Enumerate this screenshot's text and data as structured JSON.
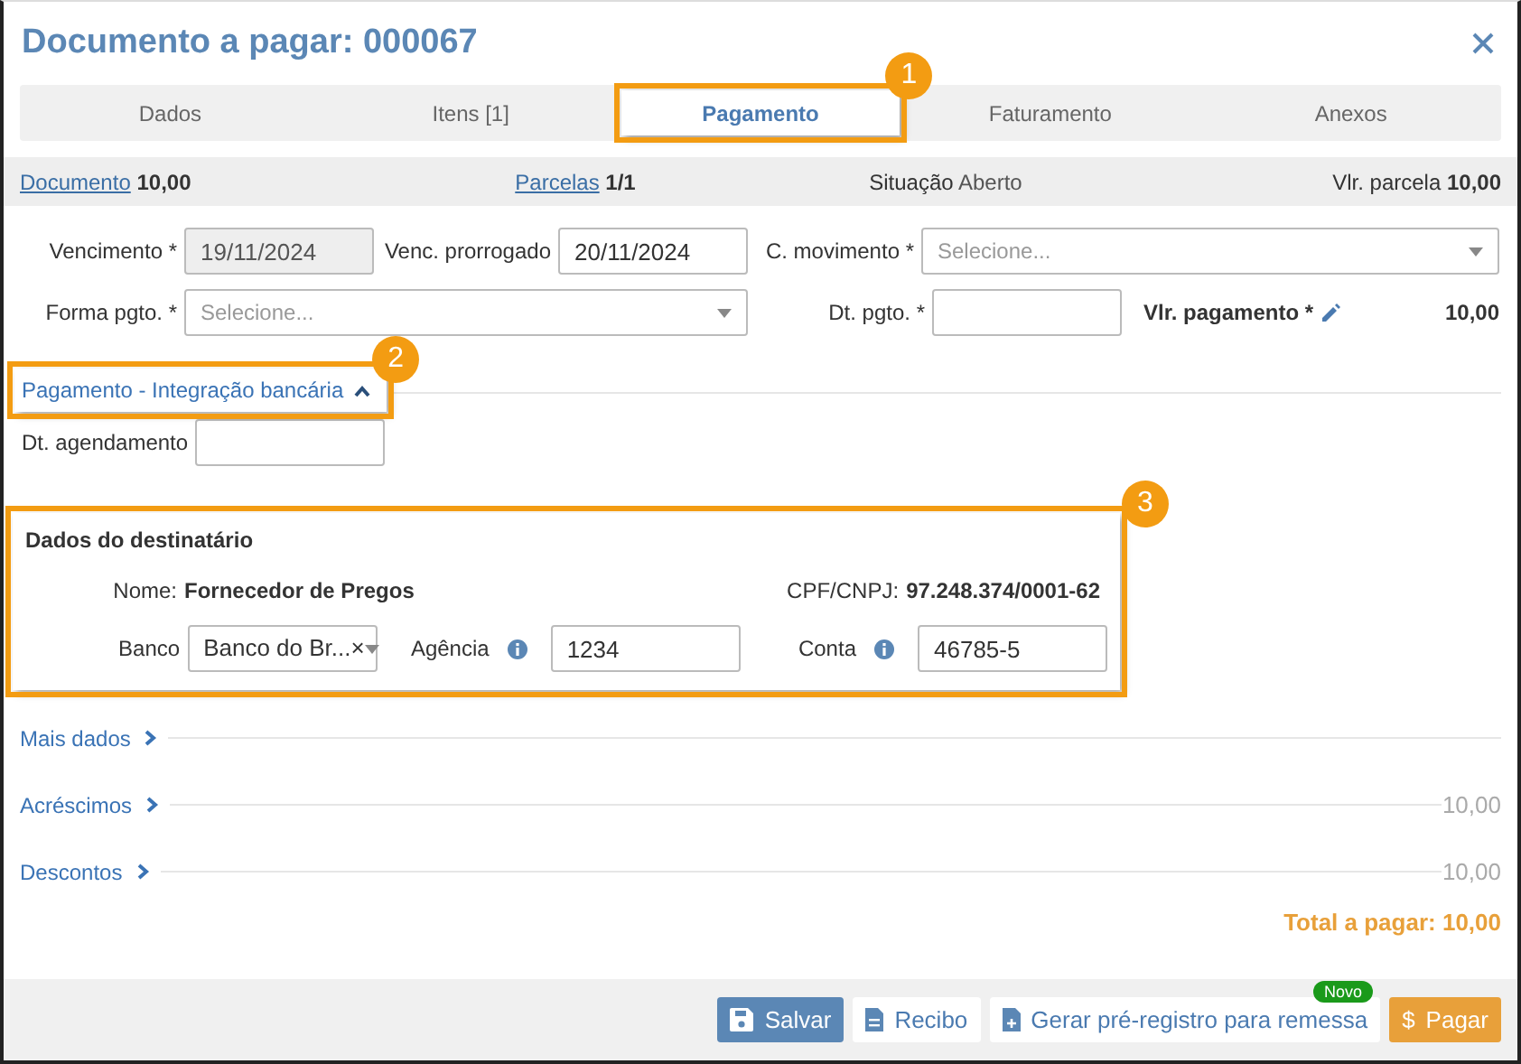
{
  "dialog": {
    "title": "Documento a pagar: 000067"
  },
  "tabs": [
    {
      "label": "Dados",
      "selected": false
    },
    {
      "label": "Itens [1]",
      "selected": false
    },
    {
      "label": "Pagamento",
      "selected": true,
      "callout": "1"
    },
    {
      "label": "Faturamento",
      "selected": false
    },
    {
      "label": "Anexos",
      "selected": false
    }
  ],
  "summary": [
    {
      "kind": "link",
      "label": "Documento",
      "value": "10,00",
      "bold": true
    },
    {
      "kind": "link",
      "label": "Parcelas",
      "value": "1/1",
      "bold": true
    },
    {
      "kind": "plain",
      "label": "Situação",
      "value": "Aberto",
      "bold": false
    },
    {
      "kind": "plain",
      "label": "Vlr. parcela",
      "value": "10,00",
      "bold": true
    }
  ],
  "form_rows": [
    [
      {
        "kind": "input",
        "label": "Vencimento *",
        "value": "19/11/2024",
        "disabled": true
      },
      {
        "kind": "input",
        "label": "Venc. prorrogado",
        "value": "20/11/2024",
        "disabled": false
      },
      {
        "kind": "select",
        "label": "C. movimento *",
        "placeholder": "Selecione..."
      }
    ],
    [
      {
        "kind": "select",
        "label": "Forma pgto. *",
        "placeholder": "Selecione..."
      },
      {
        "kind": "input",
        "label": "Dt. pgto. *",
        "disabled": false
      },
      {
        "kind": "amount",
        "label": "Vlr. pagamento *",
        "value": "10,00"
      }
    ]
  ],
  "integration": {
    "title": "Pagamento - Integração bancária",
    "expanded": true,
    "callout": "2",
    "field_label": "Dt. agendamento"
  },
  "recipient": {
    "title": "Dados do destinatário",
    "callout": "3",
    "name_label": "Nome:",
    "name": "Fornecedor de Pregos",
    "doc_label": "CPF/CNPJ:",
    "doc": "97.248.374/0001-62",
    "bank_label": "Banco",
    "bank_value": "Banco do Br...",
    "bank_clear": "×",
    "agency_label": "Agência",
    "agency": "1234",
    "account_label": "Conta",
    "account": "46785-5"
  },
  "sections": [
    {
      "title": "Mais dados",
      "expanded": false
    },
    {
      "title": "Acréscimos",
      "expanded": false,
      "value": "10,00"
    },
    {
      "title": "Descontos",
      "expanded": false,
      "value": "10,00"
    }
  ],
  "total": "Total a pagar: 10,00",
  "buttons": [
    {
      "kind": "primary",
      "label": "Salvar"
    },
    {
      "kind": "light",
      "label": "Recibo"
    },
    {
      "kind": "light",
      "label": "Gerar pré-registro para remessa",
      "badge": "Novo"
    },
    {
      "kind": "warning",
      "symbol": "$",
      "label": "Pagar"
    }
  ]
}
